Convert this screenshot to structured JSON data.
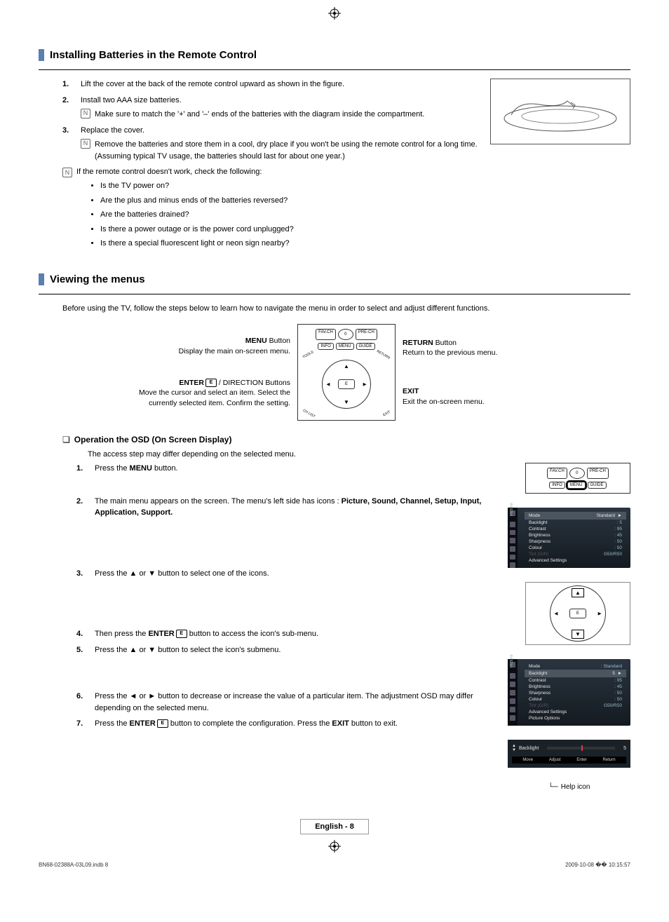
{
  "sections": {
    "batteries": {
      "title": "Installing Batteries in the Remote Control",
      "steps": [
        "Lift the cover at the back of the remote control upward as shown in the figure.",
        "Install two AAA size batteries.",
        "Replace the cover."
      ],
      "step2_note": "Make sure to match the '+' and '–' ends of the batteries with the diagram inside the compartment.",
      "step3_note": "Remove the batteries and store them in a cool, dry place if you won't be using the remote control for a long time. (Assuming typical TV usage, the batteries should last for about one year.)",
      "troubleshoot_intro": "If the remote control doesn't work, check the following:",
      "troubleshoot": [
        "Is the TV power on?",
        "Are the plus and minus ends of the batteries reversed?",
        "Are the batteries drained?",
        "Is there a power outage or is the power cord unplugged?",
        "Is there a special fluorescent light or neon sign nearby?"
      ]
    },
    "menus": {
      "title": "Viewing the menus",
      "intro": "Before using the TV, follow the steps below to learn how to navigate the menu in order to select and adjust different functions.",
      "callouts": {
        "menu_button_label": "MENU",
        "menu_button_suffix": " Button",
        "menu_desc": "Display the main on-screen menu.",
        "enter_label": "ENTER",
        "enter_suffix": " / DIRECTION Buttons",
        "enter_desc1": "Move the cursor and select an item. Select the currently selected item. Confirm the setting.",
        "return_label": "RETURN",
        "return_suffix": " Button",
        "return_desc": "Return to the previous menu.",
        "exit_label": "EXIT",
        "exit_desc": "Exit the on-screen menu."
      }
    },
    "osd": {
      "subtitle": "Operation the OSD (On Screen Display)",
      "access_note": "The access step may differ depending on the selected menu.",
      "step1_pre": "Press the ",
      "step1_bold": "MENU",
      "step1_post": " button.",
      "step2_pre": "The main menu appears on the screen. The menu's left side has icons : ",
      "step2_bold": "Picture, Sound, Channel, Setup, Input, Application, Support.",
      "step3": "Press the ▲ or ▼ button to select one of the icons.",
      "step4_pre": "Then press the ",
      "step4_bold": "ENTER",
      "step4_post": " button to access the icon's sub-menu.",
      "step5": "Press the ▲ or ▼ button to select the icon's submenu.",
      "step6": "Press the ◄ or ► button to decrease or increase the value of a particular item. The adjustment OSD may differ depending on the selected menu.",
      "step7_pre": "Press the ",
      "step7_bold1": "ENTER",
      "step7_mid": " button to complete the configuration. Press the ",
      "step7_bold2": "EXIT",
      "step7_post": " button to exit."
    }
  },
  "remote": {
    "favch": "FAV.CH",
    "zero": "0",
    "prech": "PRE-CH",
    "info": "INFO",
    "menu": "MENU",
    "guide": "GUIDE",
    "tools": "TOOLS",
    "return": "RETURN",
    "chlist": "CH LIST",
    "exit": "EXIT"
  },
  "osd_picture": {
    "tab": "Picture",
    "mode_label": "Mode",
    "mode_value": "Standard",
    "items": [
      {
        "label": "Backlight",
        "value": "5"
      },
      {
        "label": "Contrast",
        "value": "95"
      },
      {
        "label": "Brightness",
        "value": "45"
      },
      {
        "label": "Sharpness",
        "value": "50"
      },
      {
        "label": "Colour",
        "value": "50"
      },
      {
        "label": "Tint (G/R)",
        "value": "G50/R50",
        "dim": true
      },
      {
        "label": "Advanced Settings",
        "value": ""
      }
    ],
    "highlight_top": "Mode",
    "submenu_items": [
      {
        "label": "Mode",
        "value": ": Standard"
      },
      {
        "label": "Backlight",
        "value": "5",
        "hl": true
      },
      {
        "label": "Contrast",
        "value": "95"
      },
      {
        "label": "Brightness",
        "value": "45"
      },
      {
        "label": "Sharpness",
        "value": "50"
      },
      {
        "label": "Colour",
        "value": "50"
      },
      {
        "label": "Tint (G/R)",
        "value": "G50/R50",
        "dim": true
      },
      {
        "label": "Advanced Settings",
        "value": ""
      },
      {
        "label": "Picture Options",
        "value": ""
      }
    ]
  },
  "slider": {
    "label": "Backlight",
    "value": "5",
    "help": [
      "Move",
      "Adjust",
      "Enter",
      "Return"
    ]
  },
  "help_icon_label": "Help icon",
  "page_label": "English - 8",
  "footer": {
    "left": "BN68-02388A-03L09.indb   8",
    "right": "2009-10-08   �� 10:15:57"
  }
}
